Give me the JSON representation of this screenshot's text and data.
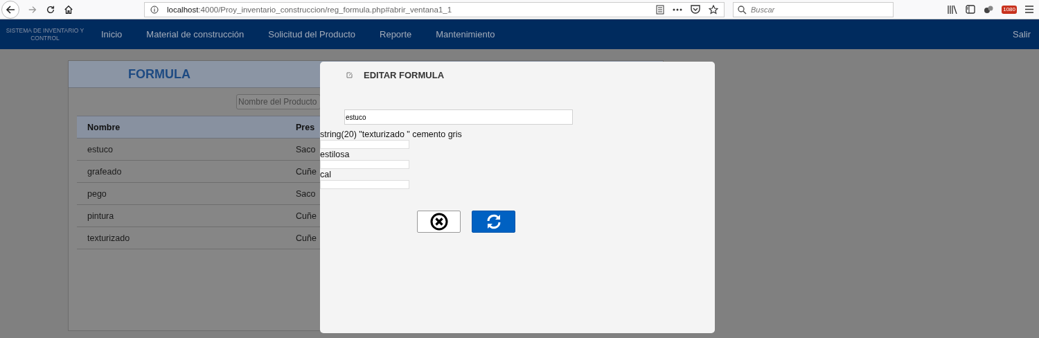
{
  "browser": {
    "url": "**localhost**:4000/Proy_inventario_construccion/reg_formula.php#abrir_ventana1_1",
    "search_placeholder": "Buscar",
    "badge": "1080"
  },
  "navbar": {
    "brand": "SISTEMA DE INVENTARIO Y CONTROL",
    "items": [
      "Inicio",
      "Material de construcción",
      "Solicitud del Producto",
      "Reporte",
      "Mantenimiento"
    ],
    "logout": "Salir"
  },
  "panel": {
    "title": "FORMULA",
    "search_placeholder": "Nombre del Producto",
    "columns": [
      "Nombre",
      "Pres"
    ],
    "rows": [
      [
        "estuco",
        "Saco"
      ],
      [
        "grafeado",
        "Cuñe"
      ],
      [
        "pego",
        "Saco"
      ],
      [
        "pintura",
        "Cuñe"
      ],
      [
        "texturizado",
        "Cuñe"
      ]
    ]
  },
  "modal": {
    "title": "EDITAR FORMULA",
    "name_value": "estuco",
    "fields": [
      {
        "label": "string(20) \"texturizado \" cemento gris"
      },
      {
        "label": "estilosa"
      },
      {
        "label": "cal"
      }
    ]
  }
}
